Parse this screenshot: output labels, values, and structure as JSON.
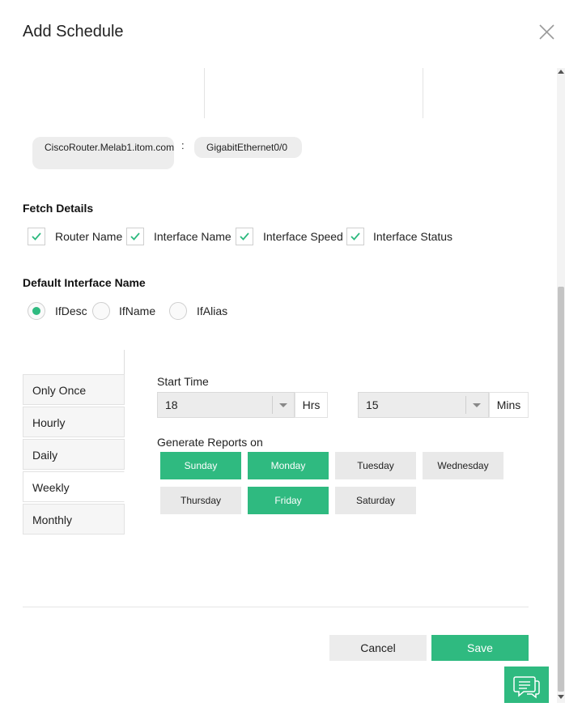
{
  "dialog": {
    "title": "Add Schedule"
  },
  "selection": {
    "router": "CiscoRouter.Melab1.itom.com",
    "separator": ":",
    "interface": "GigabitEthernet0/0"
  },
  "fetch_details": {
    "title": "Fetch Details",
    "options": [
      {
        "label": "Router Name",
        "checked": true
      },
      {
        "label": "Interface Name",
        "checked": true
      },
      {
        "label": "Interface Speed",
        "checked": true
      },
      {
        "label": "Interface Status",
        "checked": true
      }
    ]
  },
  "default_interface_name": {
    "title": "Default Interface Name",
    "options": [
      {
        "label": "IfDesc",
        "selected": true
      },
      {
        "label": "IfName",
        "selected": false
      },
      {
        "label": "IfAlias",
        "selected": false
      }
    ]
  },
  "frequency": {
    "items": [
      {
        "label": "Only Once"
      },
      {
        "label": "Hourly"
      },
      {
        "label": "Daily"
      },
      {
        "label": "Weekly"
      },
      {
        "label": "Monthly"
      }
    ],
    "active": "Weekly"
  },
  "start_time": {
    "label": "Start Time",
    "hours_value": "18",
    "hours_unit": "Hrs",
    "minutes_value": "15",
    "minutes_unit": "Mins"
  },
  "generate_reports": {
    "label": "Generate Reports on",
    "days": [
      {
        "label": "Sunday",
        "selected": true
      },
      {
        "label": "Monday",
        "selected": true
      },
      {
        "label": "Tuesday",
        "selected": false
      },
      {
        "label": "Wednesday",
        "selected": false
      },
      {
        "label": "Thursday",
        "selected": false
      },
      {
        "label": "Friday",
        "selected": true
      },
      {
        "label": "Saturday",
        "selected": false
      }
    ]
  },
  "footer": {
    "cancel_label": "Cancel",
    "save_label": "Save"
  },
  "colors": {
    "accent": "#2fba80",
    "chip_bg": "#ededed",
    "inactive_day": "#e9e9e9"
  },
  "icons": {
    "close": "close-icon",
    "chat": "chat-icon",
    "check": "check-icon"
  }
}
